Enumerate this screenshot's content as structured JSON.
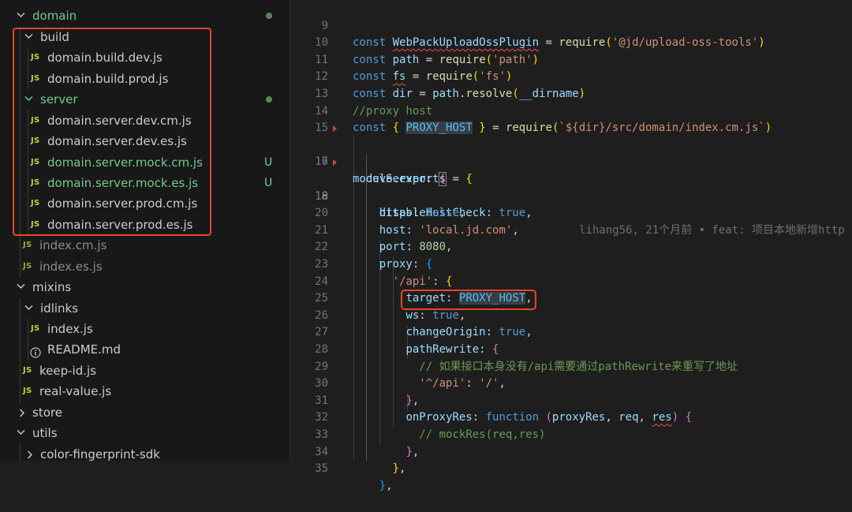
{
  "explorer": {
    "domain_folder": "domain",
    "build_folder": "build",
    "build_files": [
      "domain.build.dev.js",
      "domain.build.prod.js"
    ],
    "server_folder": "server",
    "server_files": [
      "domain.server.dev.cm.js",
      "domain.server.dev.es.js",
      "domain.server.mock.cm.js",
      "domain.server.mock.es.js",
      "domain.server.prod.cm.js",
      "domain.server.prod.es.js"
    ],
    "untracked_badge": "U",
    "domain_index_cm": "index.cm.js",
    "domain_index_es": "index.es.js",
    "mixins_folder": "mixins",
    "idlinks_folder": "idlinks",
    "idlinks_index": "index.js",
    "readme": "README.md",
    "keep_id": "keep-id.js",
    "real_value": "real-value.js",
    "store_folder": "store",
    "utils_folder": "utils",
    "color_fingerprint_folder": "color-fingerprint-sdk",
    "js_icon_text": "JS",
    "colors": {
      "untracked": "#73c991",
      "js_icon": "#cbcb41",
      "highlight": "#e8442c"
    }
  },
  "editor": {
    "line_numbers": [
      "9",
      "10",
      "11",
      "12",
      "13",
      "14",
      "15",
      "16",
      "17",
      "18",
      "19",
      "20",
      "21",
      "22",
      "23",
      "24",
      "25",
      "26",
      "27",
      "28",
      "29",
      "30",
      "31",
      "32",
      "33",
      "34",
      "35"
    ],
    "active_line": "18",
    "blame": "lihang56, 21个月前 • feat: 项目本地新增http",
    "code": {
      "l9_plugin": "WebPackUploadOssPlugin",
      "l9_pkg": "'@jd/upload-oss-tools'",
      "l10_path": "'path'",
      "l11_fs": "'fs'",
      "l12_dirname": "__dirname",
      "l13_comment": "//proxy host",
      "l14_host": "PROXY_HOST",
      "l14_tpl": "`${dir}/src/domain/index.cm.js`",
      "l19_https_val": "false",
      "l20_host_val": "'local.jd.com'",
      "l21_port_val": "8080",
      "l23_api": "'/api'",
      "l24_target_val": "PROXY_HOST",
      "l28_comment": "// 如果接口本身没有/api需要通过pathRewrite来重写了地址",
      "l29_key": "'^/api'",
      "l29_val": "'/'",
      "l32_comment": "// mockRes(req,res)"
    }
  }
}
